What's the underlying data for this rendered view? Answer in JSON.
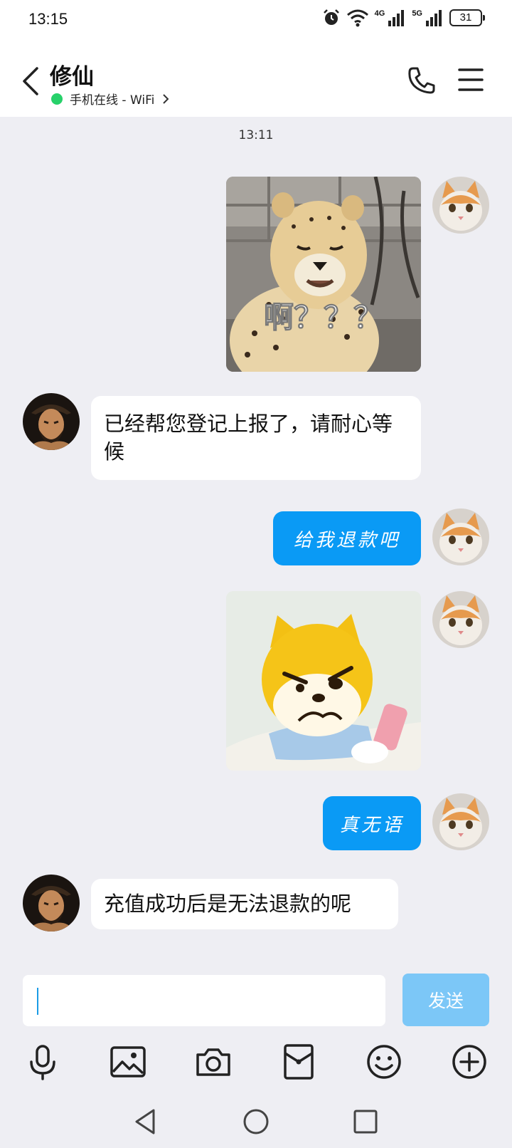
{
  "status_bar": {
    "time": "13:15",
    "network_1": "4G",
    "network_2": "5G",
    "battery": "31"
  },
  "header": {
    "contact_name": "修仙",
    "presence": "手机在线 - WiFi"
  },
  "chat": {
    "timestamp": "13:11",
    "messages": [
      {
        "side": "out",
        "type": "sticker",
        "caption": "啊？？？"
      },
      {
        "side": "in",
        "type": "text",
        "text": "已经帮您登记上报了，请耐心等候"
      },
      {
        "side": "out",
        "type": "text",
        "text": "给我退款吧"
      },
      {
        "side": "out",
        "type": "sticker",
        "caption": ""
      },
      {
        "side": "out",
        "type": "text",
        "text": "真无语"
      },
      {
        "side": "in",
        "type": "text",
        "text": "充值成功后是无法退款的呢"
      }
    ]
  },
  "input": {
    "placeholder": "",
    "value": "",
    "send_label": "发送"
  },
  "toolbar": {
    "icons": [
      "microphone-icon",
      "image-icon",
      "camera-icon",
      "red-packet-icon",
      "emoji-icon",
      "plus-icon"
    ]
  },
  "colors": {
    "outgoing_bubble": "#0a9af5",
    "incoming_bubble": "#ffffff",
    "send_button": "#7cc7f7",
    "online_dot": "#27d16a",
    "chat_background": "#eeeef3"
  }
}
